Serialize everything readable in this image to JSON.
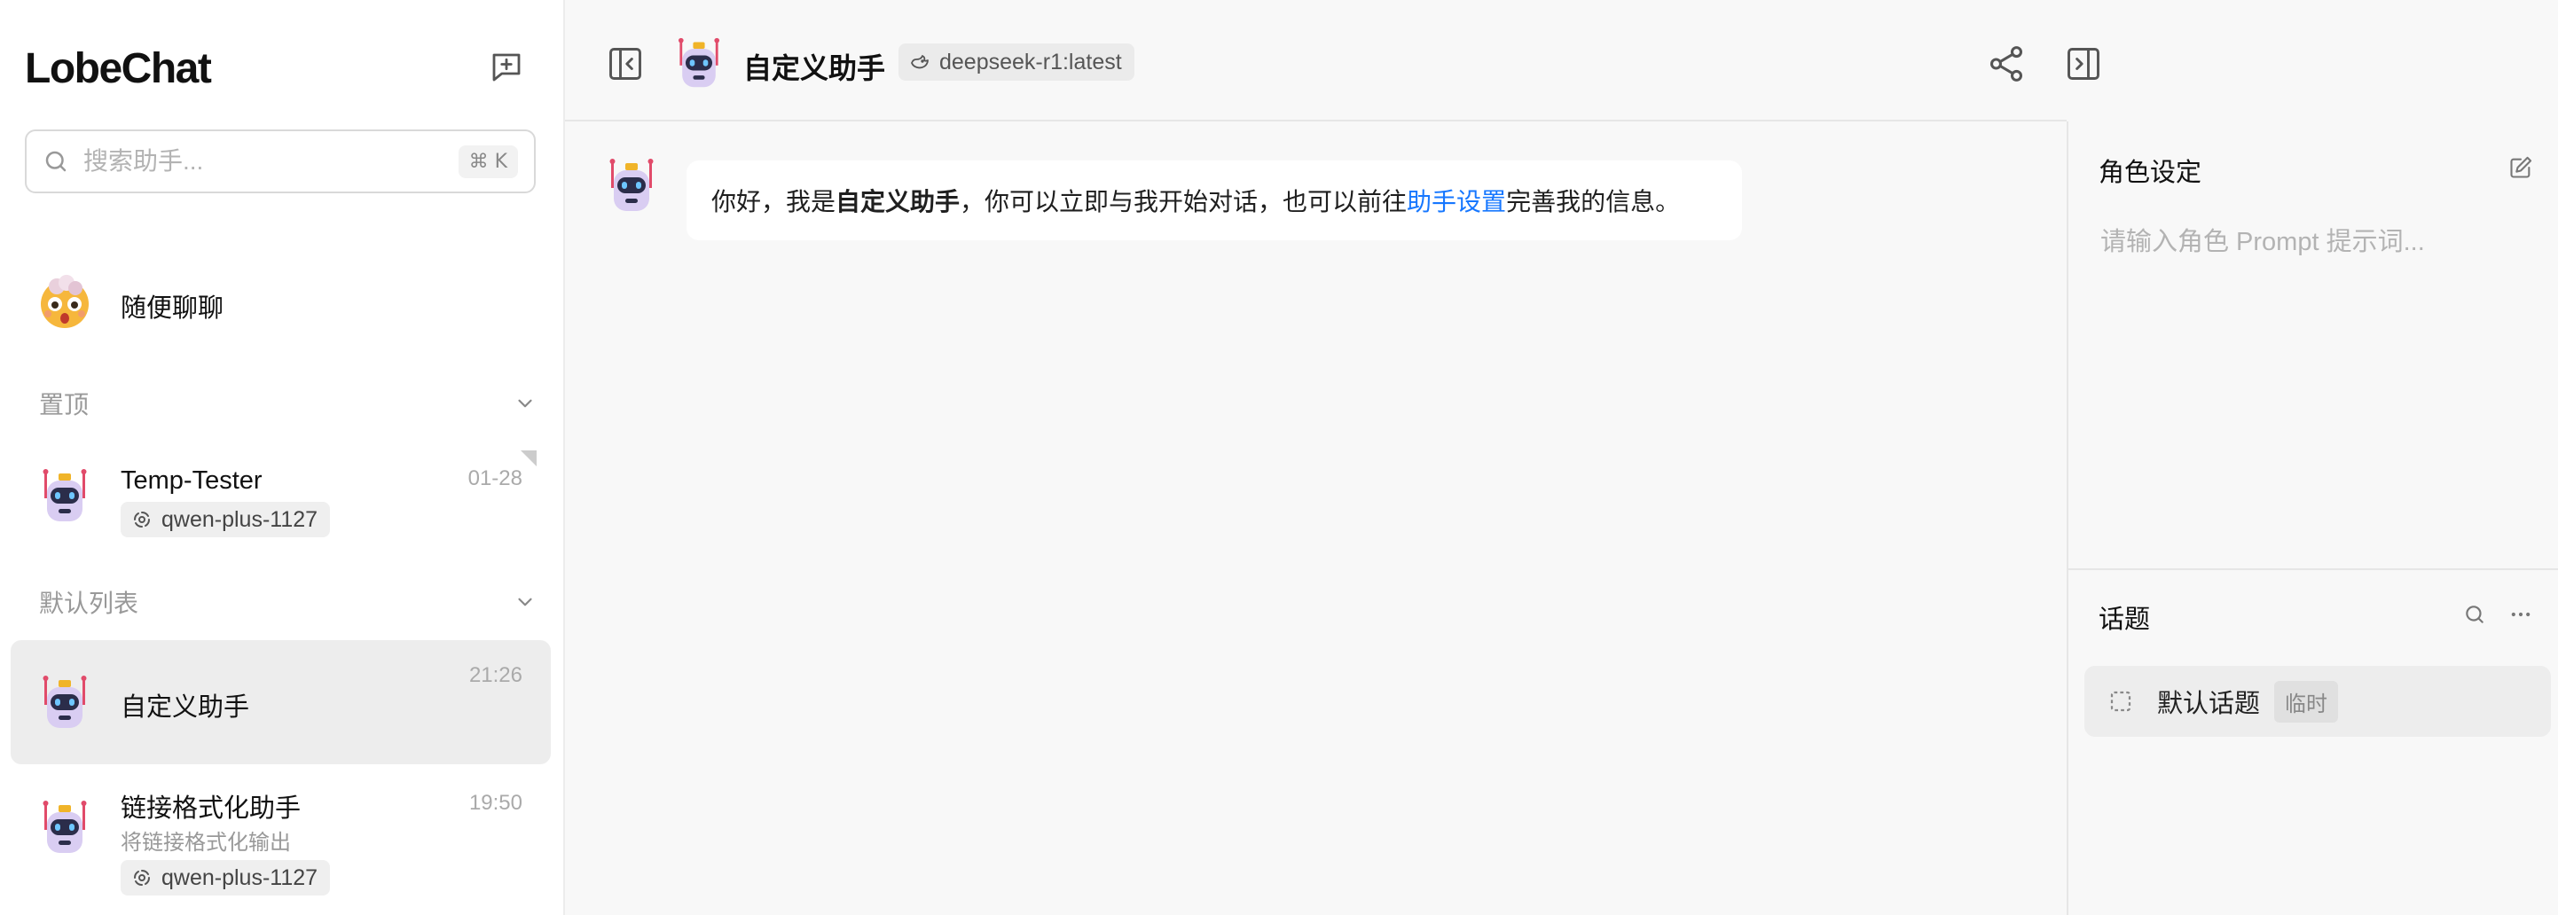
{
  "app": {
    "name": "LobeChat"
  },
  "sidebar": {
    "search": {
      "placeholder": "搜索助手...",
      "shortcut": "⌘ K"
    },
    "random_chat": {
      "label": "随便聊聊"
    },
    "pinned_group": {
      "label": "置顶"
    },
    "pinned_items": [
      {
        "title": "Temp-Tester",
        "time": "01-28",
        "model": "qwen-plus-1127"
      }
    ],
    "default_group": {
      "label": "默认列表"
    },
    "default_items": [
      {
        "title": "自定义助手",
        "time": "21:26",
        "active": true
      },
      {
        "title": "链接格式化助手",
        "subtitle": "将链接格式化输出",
        "time": "19:50",
        "model": "qwen-plus-1127"
      }
    ]
  },
  "header": {
    "title": "自定义助手",
    "model": "deepseek-r1:latest"
  },
  "chat": {
    "messages": [
      {
        "part1": "你好，我是 ",
        "name": "自定义助手",
        "part2": "，你可以立即与我开始对话，也可以前往 ",
        "link": "助手设置",
        "part3": " 完善我的信息。"
      }
    ]
  },
  "right_panel": {
    "role_title": "角色设定",
    "prompt_placeholder": "请输入角色 Prompt 提示词...",
    "topics_title": "话题",
    "topics": [
      {
        "label": "默认话题",
        "badge": "临时"
      }
    ]
  },
  "colors": {
    "accent": "#1677ff",
    "active_bg": "#ededed",
    "surface": "#f8f8f8"
  },
  "icons": [
    "new-chat-icon",
    "search-icon",
    "bot-avatar",
    "cyclone-model-icon",
    "whale-model-icon",
    "chevron-down-icon",
    "sidebar-collapse-icon",
    "share-icon",
    "panel-toggle-icon",
    "menu-icon",
    "edit-icon",
    "ellipsis-icon",
    "dashed-square-icon"
  ]
}
